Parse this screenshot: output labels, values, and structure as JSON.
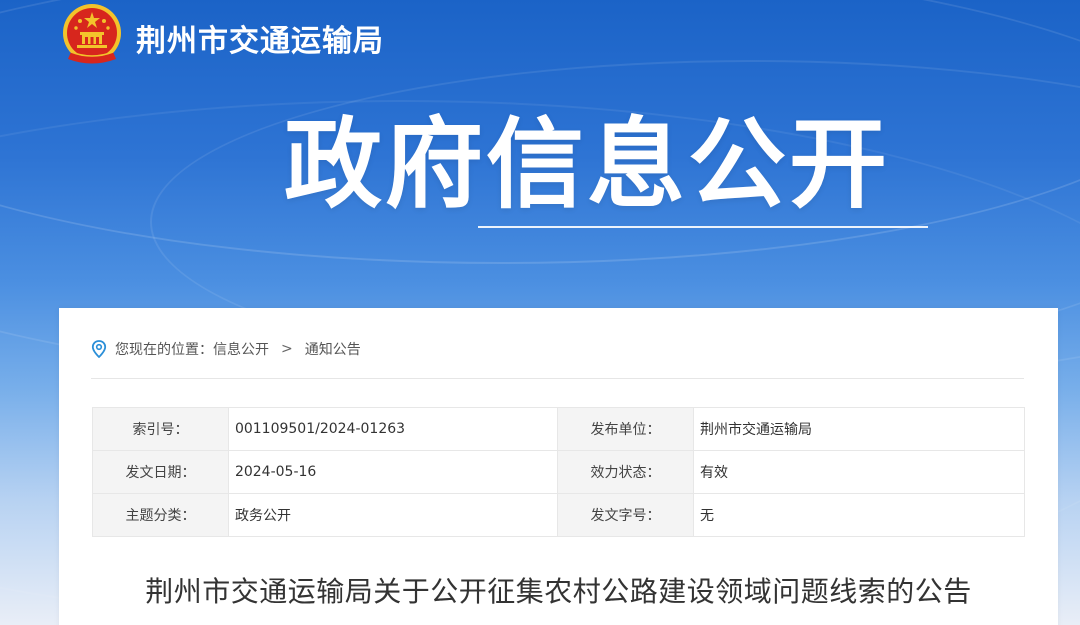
{
  "header": {
    "site_title": "荆州市交通运输局",
    "emblem_icon": "national-emblem-icon"
  },
  "hero": {
    "title": "政府信息公开"
  },
  "breadcrumb": {
    "icon": "location-pin-icon",
    "prefix": "您现在的位置：",
    "items": [
      "信息公开",
      "通知公告"
    ],
    "separator": ">"
  },
  "meta": {
    "rows": [
      {
        "label1": "索引号：",
        "value1": "001109501/2024-01263",
        "label2": "发布单位：",
        "value2": "荆州市交通运输局"
      },
      {
        "label1": "发文日期：",
        "value1": "2024-05-16",
        "label2": "效力状态：",
        "value2": "有效"
      },
      {
        "label1": "主题分类：",
        "value1": "政务公开",
        "label2": "发文字号：",
        "value2": "无"
      }
    ]
  },
  "article": {
    "title": "荆州市交通运输局关于公开征集农村公路建设领域问题线索的公告"
  },
  "colors": {
    "banner_top": "#1b63c7",
    "banner_mid": "#4b8fe1",
    "page_bg": "#e9eef7",
    "emblem_red": "#d7261d",
    "emblem_gold": "#f3c32b",
    "location_icon": "#2b8fd8"
  }
}
